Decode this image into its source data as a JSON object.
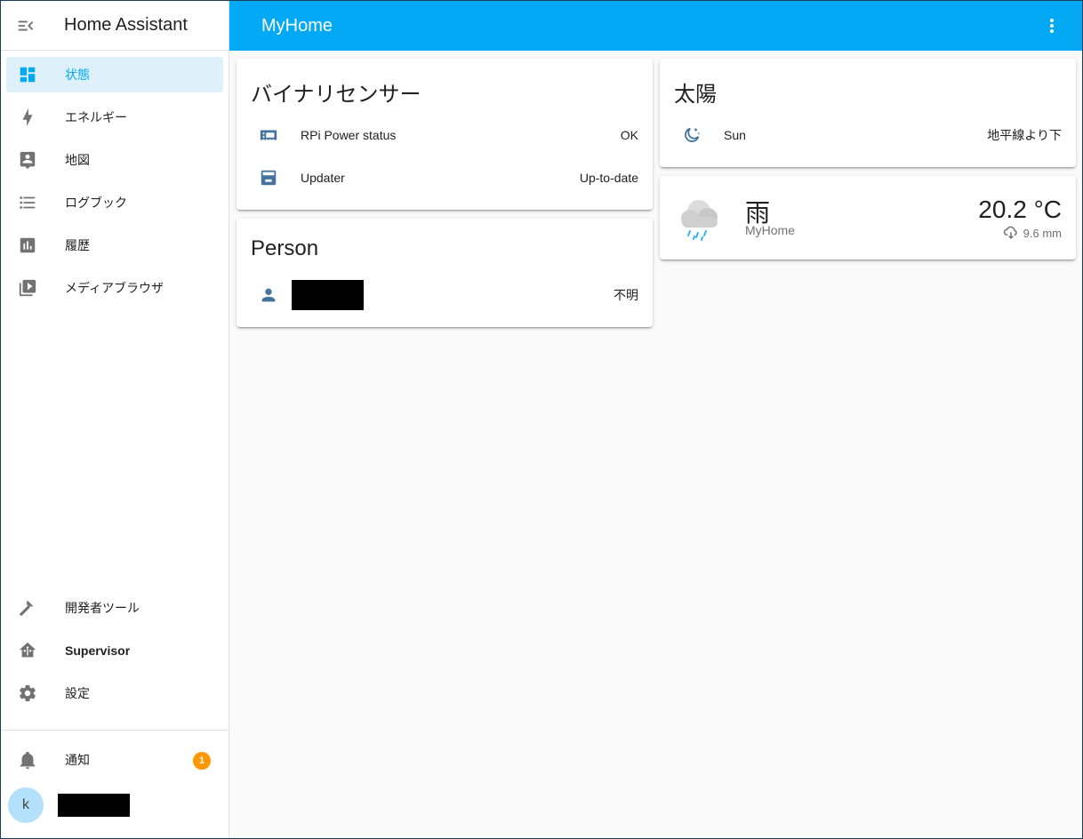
{
  "sidebar": {
    "title": "Home Assistant",
    "items": [
      {
        "label": "状態",
        "icon": "dashboard-icon",
        "active": true
      },
      {
        "label": "エネルギー",
        "icon": "lightning-bolt-icon"
      },
      {
        "label": "地図",
        "icon": "map-account-icon"
      },
      {
        "label": "ログブック",
        "icon": "format-list-bulleted-icon"
      },
      {
        "label": "履歴",
        "icon": "chart-box-icon"
      },
      {
        "label": "メディアブラウザ",
        "icon": "play-box-multiple-icon"
      }
    ],
    "bottom_items": [
      {
        "label": "開発者ツール",
        "icon": "hammer-icon"
      },
      {
        "label": "Supervisor",
        "icon": "home-assistant-icon"
      },
      {
        "label": "設定",
        "icon": "cog-icon"
      }
    ],
    "notifications": {
      "label": "通知",
      "count": "1",
      "icon": "bell-icon"
    },
    "user": {
      "initial": "k"
    }
  },
  "header": {
    "title": "MyHome"
  },
  "cards": {
    "binary_sensor": {
      "title": "バイナリセンサー",
      "rows": [
        {
          "name": "RPi Power status",
          "state": "OK",
          "icon": "raspberry-pi-power-icon"
        },
        {
          "name": "Updater",
          "state": "Up-to-date",
          "icon": "package-up-icon"
        }
      ]
    },
    "person": {
      "title": "Person",
      "rows": [
        {
          "state": "不明",
          "icon": "account-icon"
        }
      ]
    },
    "sun": {
      "title": "太陽",
      "rows": [
        {
          "name": "Sun",
          "state": "地平線より下",
          "icon": "weather-night-icon"
        }
      ]
    },
    "weather": {
      "condition": "雨",
      "name": "MyHome",
      "temperature": "20.2 °C",
      "precipitation": "9.6 mm",
      "icon": "weather-rainy-icon"
    }
  },
  "colors": {
    "primary": "#03a9f4",
    "sidebar_active_bg": "#def1fa",
    "icon": "#44739e",
    "badge": "#ff9800"
  }
}
